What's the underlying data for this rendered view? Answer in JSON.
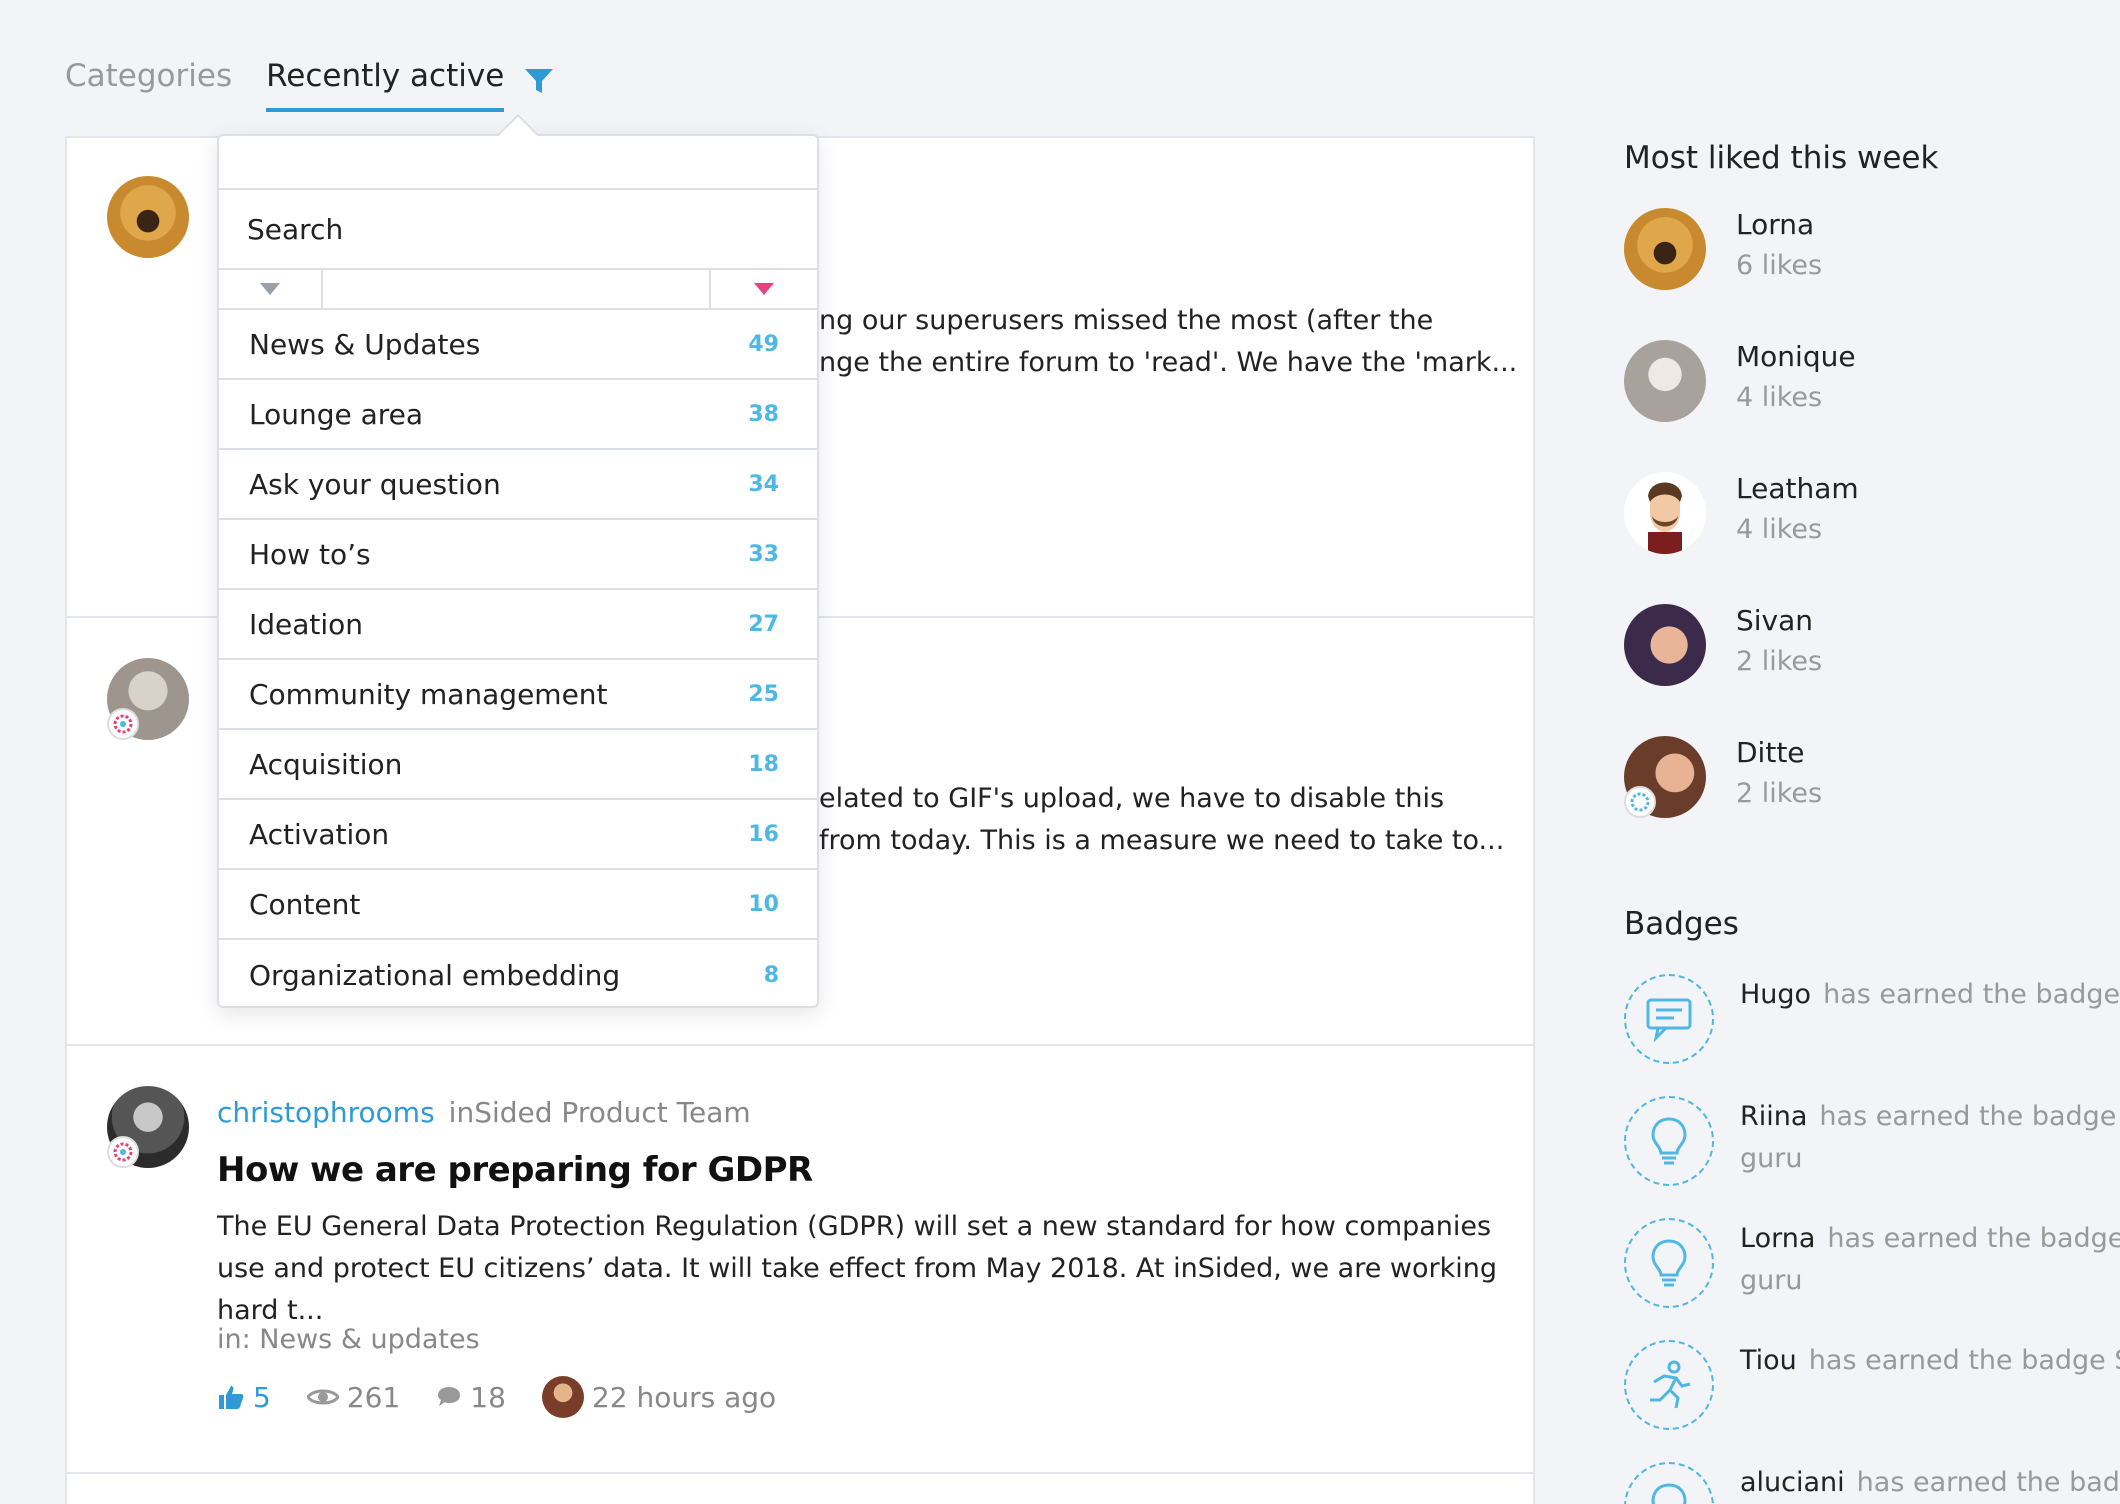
{
  "tabs": [
    {
      "label": "Categories"
    },
    {
      "label": "Recently active"
    }
  ],
  "dropdown": {
    "search_placeholder": "Search",
    "items": [
      {
        "label": "News & Updates",
        "count": "49"
      },
      {
        "label": "Lounge area",
        "count": "38"
      },
      {
        "label": "Ask your question",
        "count": "34"
      },
      {
        "label": "How to’s",
        "count": "33"
      },
      {
        "label": "Ideation",
        "count": "27"
      },
      {
        "label": "Community management",
        "count": "25"
      },
      {
        "label": "Acquisition",
        "count": "18"
      },
      {
        "label": "Activation",
        "count": "16"
      },
      {
        "label": "Content",
        "count": "10"
      },
      {
        "label": "Organizational embedding",
        "count": "8"
      }
    ]
  },
  "posts": [
    {
      "excerpt_line1": "ng our superusers missed the most (after the",
      "excerpt_line2": "nge the entire forum to 'read'. We have the 'mark..."
    },
    {
      "excerpt_line1": "elated to GIF's upload, we have to disable this",
      "excerpt_line2": " from today. This is a measure we need to take to..."
    },
    {
      "author": "christophrooms",
      "role": "inSided Product Team",
      "title": "How we are preparing for GDPR",
      "excerpt": "The EU General Data Protection Regulation (GDPR) will set a new standard for how companies use and protect EU citizens’ data. It will take effect from May 2018. At inSided, we are working hard t...",
      "category": "in: News & updates",
      "likes": "5",
      "views": "261",
      "comments": "18",
      "time": "22 hours ago"
    }
  ],
  "sidebar": {
    "most_liked_title": "Most liked this week",
    "likers": [
      {
        "name": "Lorna",
        "likes": "6 likes"
      },
      {
        "name": "Monique",
        "likes": "4 likes"
      },
      {
        "name": "Leatham",
        "likes": "4 likes"
      },
      {
        "name": "Sivan",
        "likes": "2 likes"
      },
      {
        "name": "Ditte",
        "likes": "2 likes"
      }
    ],
    "badges_title": "Badges",
    "badges": [
      {
        "user": "Hugo",
        "text": "has earned the badge I"
      },
      {
        "user": "Riina",
        "text": "has earned the badge Id",
        "line2": "guru"
      },
      {
        "user": "Lorna",
        "text": "has earned the badge I",
        "line2": "guru"
      },
      {
        "user": "Tiou",
        "text": "has earned the badge Sp"
      },
      {
        "user": "aluciani",
        "text": "has earned the badg"
      }
    ]
  },
  "colors": {
    "accent": "#2e9bd6",
    "count": "#4fb7e3",
    "sort_active": "#e6437e"
  }
}
